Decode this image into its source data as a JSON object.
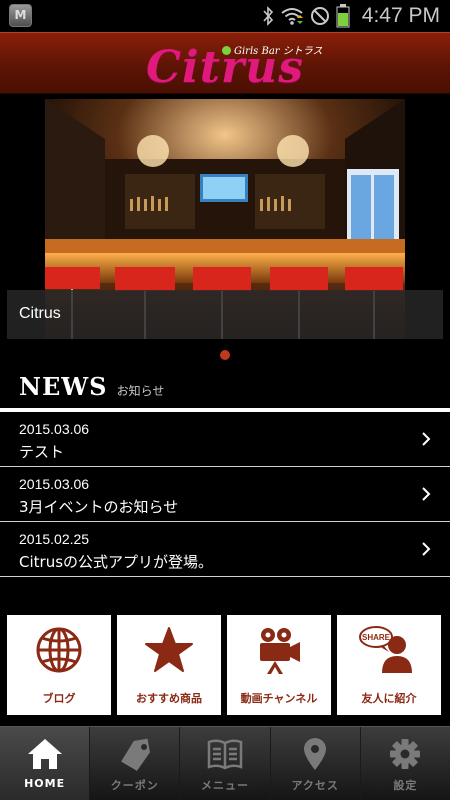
{
  "status_bar": {
    "time": "4:47 PM",
    "app_icon_letter": "M"
  },
  "header": {
    "logo_text": "Citrus",
    "logo_subtext": "Girls Bar シトラス"
  },
  "hero": {
    "caption": "Citrus"
  },
  "news": {
    "title": "NEWS",
    "subtitle": "お知らせ",
    "items": [
      {
        "date": "2015.03.06",
        "text": "テスト"
      },
      {
        "date": "2015.03.06",
        "text": "3月イベントのお知らせ"
      },
      {
        "date": "2015.02.25",
        "text": "Citrusの公式アプリが登場。"
      }
    ]
  },
  "tiles": [
    {
      "label": "ブログ",
      "icon": "globe-icon"
    },
    {
      "label": "おすすめ商品",
      "icon": "star-icon"
    },
    {
      "label": "動画チャンネル",
      "icon": "video-camera-icon"
    },
    {
      "label": "友人に紹介",
      "icon": "share-person-icon",
      "icon_text": "SHARE"
    }
  ],
  "tabbar": [
    {
      "label": "HOME",
      "icon": "home-icon",
      "active": true
    },
    {
      "label": "クーポン",
      "icon": "coupon-tag-icon",
      "active": false
    },
    {
      "label": "メニュー",
      "icon": "menu-book-icon",
      "active": false
    },
    {
      "label": "アクセス",
      "icon": "map-pin-icon",
      "active": false
    },
    {
      "label": "設定",
      "icon": "gear-icon",
      "active": false
    }
  ],
  "colors": {
    "accent": "#8b2a14",
    "logo": "#e0197d",
    "header": "#5e1404",
    "pager_dot": "#c0391b"
  }
}
